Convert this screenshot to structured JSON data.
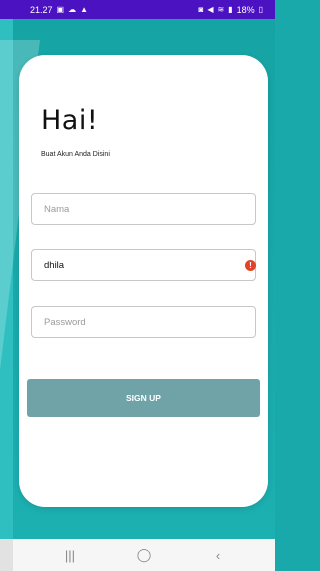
{
  "status_bar": {
    "time": "21.27",
    "left_icons": [
      "message-icon",
      "cloud-icon",
      "warning-icon"
    ],
    "right_text": "18%",
    "right_icons": [
      "alarm-icon",
      "mute-icon",
      "wifi-icon",
      "signal-icon",
      "battery-icon"
    ]
  },
  "card": {
    "title": "Hai!",
    "subtitle": "Buat Akun Anda Disini",
    "fields": {
      "name_placeholder": "Nama",
      "username_value": "dhila",
      "password_placeholder": "Password"
    },
    "error_icon": "!",
    "signup_label": "SIGN UP"
  },
  "nav": {
    "recent": "|||",
    "home": "◯",
    "back": "‹"
  },
  "colors": {
    "status_bar": "#4b12c2",
    "background": "#1aa9aa",
    "button": "#6fa3a8",
    "error": "#e0452a"
  }
}
